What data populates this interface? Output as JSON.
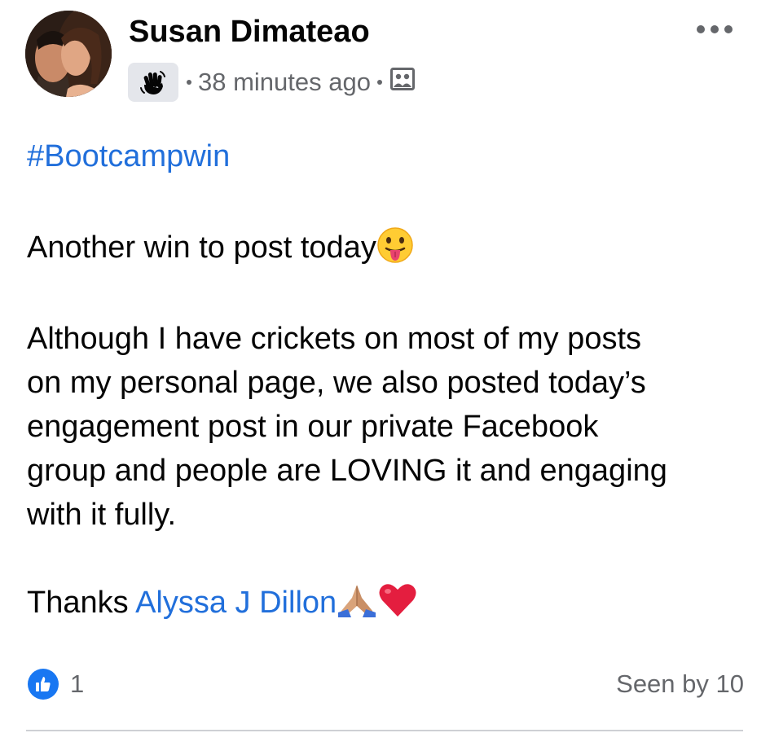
{
  "post": {
    "author": "Susan Dimateao",
    "badge_icon": "waving-hand-icon",
    "timestamp": "38 minutes ago",
    "audience_icon": "group-members-icon",
    "more_icon": "more-options-icon",
    "hashtag": "#Bootcampwin",
    "line1": "Another win to post today",
    "line1_emoji": "tongue-out-face-emoji",
    "paragraph": [
      "Although I have crickets on most of my posts",
      "on my personal page, we also posted today’s",
      "engagement post in our private Facebook",
      "group and people are LOVING it and engaging",
      "with it fully."
    ],
    "thanks_prefix": "Thanks ",
    "mention": "Alyssa J Dillon",
    "thanks_emojis": [
      "folded-hands-emoji",
      "red-heart-emoji"
    ],
    "colors": {
      "link": "#216fdb",
      "secondary_text": "#65676b",
      "like_blue": "#1877f2",
      "heart_red": "#e41e3f"
    }
  },
  "footer": {
    "reaction_icon": "like-icon",
    "reaction_count": "1",
    "seen_by": "Seen by 10"
  }
}
